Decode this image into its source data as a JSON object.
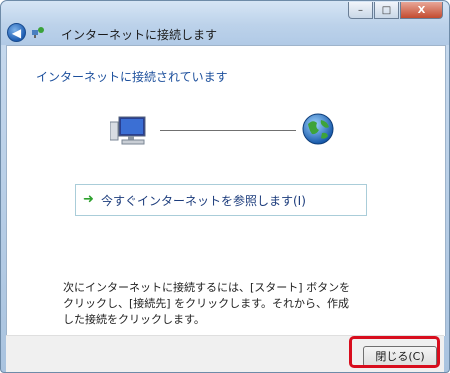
{
  "window": {
    "title": "インターネットに接続します",
    "caption_buttons": {
      "minimize": "–",
      "maximize": "□",
      "close": "X"
    },
    "back_icon": "back-arrow-icon"
  },
  "main": {
    "heading": "インターネットに接続されています",
    "connection_left_icon": "computer-icon",
    "connection_right_icon": "globe-icon",
    "option": {
      "icon": "green-arrow-icon",
      "label": "今すぐインターネットを参照します(I)"
    },
    "info_text": "次にインターネットに接続するには、[スタート] ボタンをクリックし、[接続先] をクリックします。それから、作成した接続をクリックします。"
  },
  "footer": {
    "close_label": "閉じる(C)"
  },
  "colors": {
    "highlight": "#d80d1d",
    "heading": "#1c4f9c"
  }
}
